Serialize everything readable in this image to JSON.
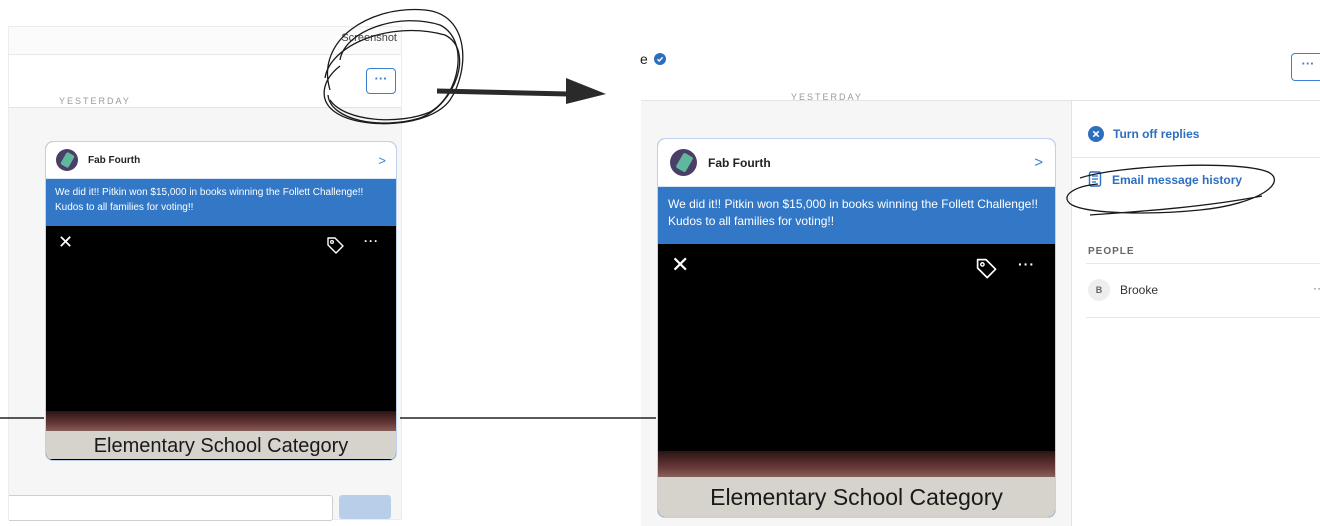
{
  "left": {
    "screenshot_label": "Screenshot",
    "more_label": "···",
    "yesterday": "YESTERDAY",
    "card": {
      "sender": "Fab Fourth",
      "chevron": ">",
      "message": "We did it!! Pitkin won $15,000 in books winning the Follett Challenge!! Kudos to all families for voting!!",
      "close_glyph": "✕",
      "more_glyph": "···",
      "photo_caption": "Elementary School Category"
    }
  },
  "right": {
    "title_fragment": "e",
    "more_label": "···",
    "yesterday": "YESTERDAY",
    "card": {
      "sender": "Fab Fourth",
      "chevron": ">",
      "message": "We did it!! Pitkin won $15,000 in books winning the Follett Challenge!! Kudos to all families for voting!!",
      "close_glyph": "✕",
      "more_glyph": "···",
      "photo_caption": "Elementary School Category"
    },
    "sidebar": {
      "turn_off_replies": "Turn off replies",
      "email_history": "Email message history",
      "people_heading": "PEOPLE",
      "people": [
        {
          "initial": "B",
          "name": "Brooke",
          "more": "··"
        }
      ]
    }
  },
  "icons": {
    "verified": "verified-badge-icon",
    "turn_off": "close-circle-icon",
    "email": "document-icon",
    "tag": "tag-icon"
  },
  "colors": {
    "accent": "#3278c7",
    "link": "#2d6fbf",
    "background": "#f6f6f6"
  }
}
